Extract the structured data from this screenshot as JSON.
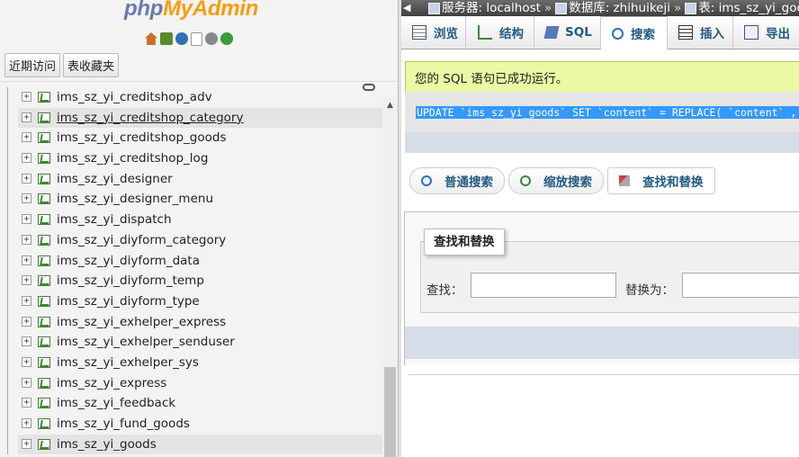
{
  "nav": {
    "logo_php": "php",
    "logo_myadmin": "MyAdmin",
    "icons": [
      "home-icon",
      "exit-icon",
      "help-icon",
      "docs-icon",
      "settings-icon",
      "reload-icon"
    ],
    "tabs": [
      "近期访问",
      "表收藏夹"
    ],
    "tables": [
      {
        "name": "ims_sz_yi_creditshop_adv",
        "highlight": false
      },
      {
        "name": "ims_sz_yi_creditshop_category",
        "highlight": true
      },
      {
        "name": "ims_sz_yi_creditshop_goods",
        "highlight": false
      },
      {
        "name": "ims_sz_yi_creditshop_log",
        "highlight": false
      },
      {
        "name": "ims_sz_yi_designer",
        "highlight": false
      },
      {
        "name": "ims_sz_yi_designer_menu",
        "highlight": false
      },
      {
        "name": "ims_sz_yi_dispatch",
        "highlight": false
      },
      {
        "name": "ims_sz_yi_diyform_category",
        "highlight": false
      },
      {
        "name": "ims_sz_yi_diyform_data",
        "highlight": false
      },
      {
        "name": "ims_sz_yi_diyform_temp",
        "highlight": false
      },
      {
        "name": "ims_sz_yi_diyform_type",
        "highlight": false
      },
      {
        "name": "ims_sz_yi_exhelper_express",
        "highlight": false
      },
      {
        "name": "ims_sz_yi_exhelper_senduser",
        "highlight": false
      },
      {
        "name": "ims_sz_yi_exhelper_sys",
        "highlight": false
      },
      {
        "name": "ims_sz_yi_express",
        "highlight": false
      },
      {
        "name": "ims_sz_yi_feedback",
        "highlight": false
      },
      {
        "name": "ims_sz_yi_fund_goods",
        "highlight": false
      },
      {
        "name": "ims_sz_yi_goods",
        "highlight": true
      }
    ]
  },
  "breadcrumb": {
    "server_label": "服务器: localhost",
    "db_label": "数据库: zhihuikeji",
    "table_label": "表: ims_sz_yi_goods",
    "separator": "»"
  },
  "tabs": [
    {
      "label": "浏览",
      "icon": "browse-icon"
    },
    {
      "label": "结构",
      "icon": "structure-icon"
    },
    {
      "label": "SQL",
      "icon": "sql-icon"
    },
    {
      "label": "搜索",
      "icon": "search-icon",
      "active": true
    },
    {
      "label": "插入",
      "icon": "insert-icon"
    },
    {
      "label": "导出",
      "icon": "export-icon"
    }
  ],
  "message": {
    "success": "您的 SQL 语句已成功运行。",
    "sql": "UPDATE `ims_sz_yi_goods` SET `content` = REPLACE( `content` , '"
  },
  "search_tabs": [
    {
      "label": "普通搜索"
    },
    {
      "label": "缩放搜索"
    },
    {
      "label": "查找和替换",
      "active": true
    }
  ],
  "form": {
    "legend": "查找和替换",
    "find_label": "查找：",
    "find_value": "",
    "replace_label": "替换为：",
    "replace_value": ""
  }
}
